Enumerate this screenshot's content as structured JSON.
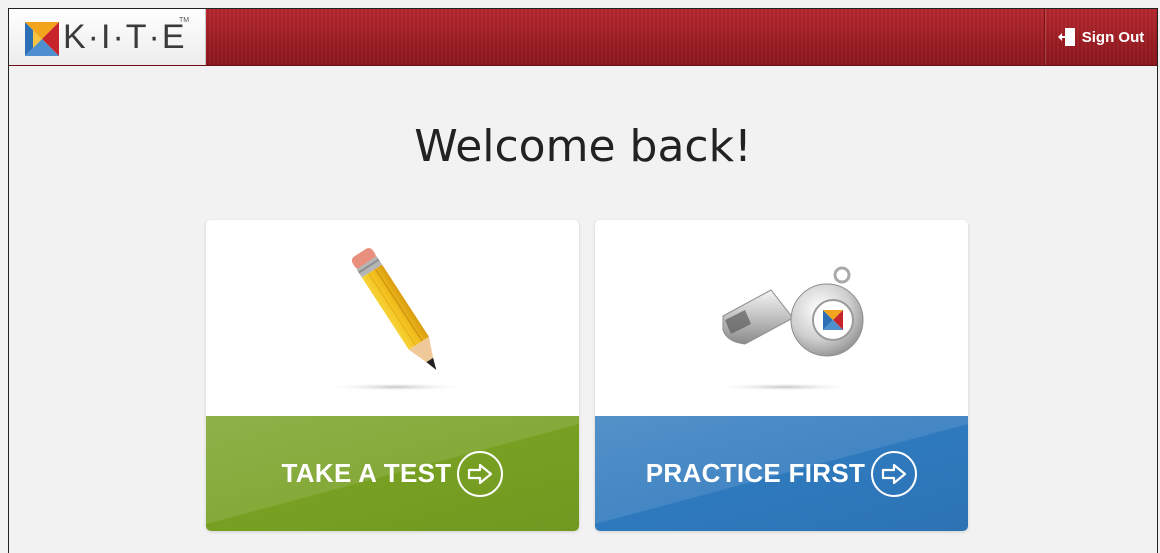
{
  "header": {
    "logo_text": "K·I·T·E",
    "logo_tm": "TM",
    "signout_label": "Sign Out"
  },
  "main": {
    "welcome": "Welcome back!"
  },
  "cards": [
    {
      "label": "TAKE A TEST",
      "icon": "pencil-icon",
      "color": "#77a022"
    },
    {
      "label": "PRACTICE FIRST",
      "icon": "whistle-icon",
      "color": "#2e79bd"
    }
  ],
  "colors": {
    "topbar": "#a5222a",
    "green": "#77a022",
    "blue": "#2e79bd"
  }
}
